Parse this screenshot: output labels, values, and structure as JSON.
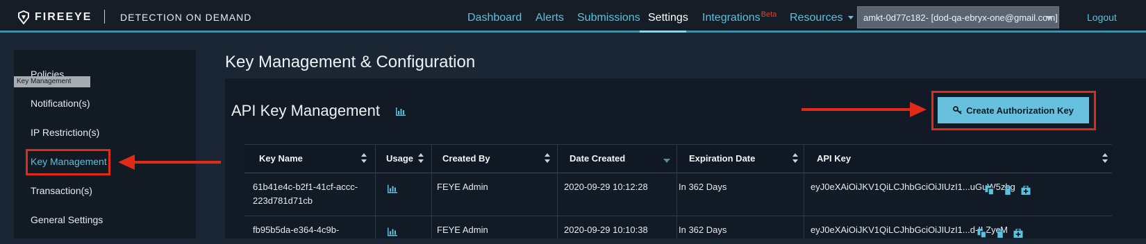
{
  "brand": {
    "logo_text": "FIREEYE",
    "product_name": "DETECTION ON DEMAND"
  },
  "nav": {
    "items": [
      {
        "label": "Dashboard"
      },
      {
        "label": "Alerts"
      },
      {
        "label": "Submissions"
      },
      {
        "label": "Settings",
        "active": true
      },
      {
        "label": "Integrations",
        "badge": "Beta"
      },
      {
        "label": "Resources"
      }
    ],
    "account": "amkt-0d77c182- [dod-qa-ebryx-one@gmail.com]",
    "logout": "Logout"
  },
  "sidebar": {
    "items": [
      {
        "label": "Policies"
      },
      {
        "label": "Notification(s)"
      },
      {
        "label": "IP Restriction(s)"
      },
      {
        "label": "Key Management",
        "active": true
      },
      {
        "label": "Transaction(s)"
      },
      {
        "label": "General Settings"
      }
    ],
    "tooltip": "Key Management"
  },
  "page": {
    "title": "Key Management & Configuration",
    "panel_title": "API Key Management",
    "create_button": "Create Authorization Key"
  },
  "table": {
    "columns": [
      "Key Name",
      "Usage",
      "Created By",
      "Date Created",
      "Expiration Date",
      "API Key"
    ],
    "rows": [
      {
        "key_name_line1": "61b41e4c-b2f1-41cf-accc-",
        "key_name_line2": "223d781d71cb",
        "created_by": "FEYE Admin",
        "date_created": "2020-09-29 10:12:28",
        "expiration": "In 362 Days",
        "api_key": "eyJ0eXAiOiJKV1QiLCJhbGciOiJIUzI1...uGuW5zbg"
      },
      {
        "key_name_line1": "fb95b5da-e364-4c9b-",
        "key_name_line2": "",
        "created_by": "FEYE Admin",
        "date_created": "2020-09-29 10:10:38",
        "expiration": "In 362 Days",
        "api_key": "eyJ0eXAiOiJKV1QiLCJhbGciOiJIUzI1...d-ILZycM"
      }
    ]
  },
  "colors": {
    "accent": "#5bc2de",
    "button": "#67c0de",
    "highlight": "#e12a18",
    "beta": "#e0442d"
  }
}
